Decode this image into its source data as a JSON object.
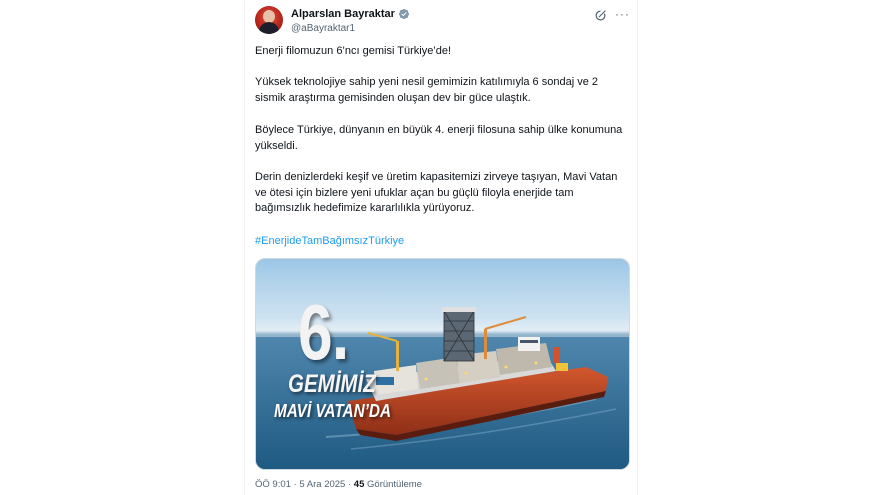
{
  "author": {
    "name": "Alparslan Bayraktar",
    "handle": "@aBayraktar1",
    "verified_color": "#829aab"
  },
  "tweet": {
    "paragraphs": [
      "Enerji filomuzun 6’ncı gemisi Türkiye’de!",
      "Yüksek teknolojiye sahip yeni nesil gemimizin katılımıyla 6 sondaj ve 2 sismik araştırma gemisinden oluşan dev bir güce ulaştık.",
      "Böylece Türkiye, dünyanın en büyük 4. enerji filosuna sahip ülke konumuna yükseldi.",
      "Derin denizlerdeki keşif ve üretim kapasitemizi zirveye taşıyan, Mavi Vatan ve ötesi için bizlere yeni ufuklar açan bu güçlü filoyla enerjide tam bağımsızlık hedefimize kararlılıkla yürüyoruz."
    ],
    "hashtag": "#EnerjideTamBağımsızTürkiye",
    "hashtag_color": "#1d9bf0"
  },
  "media": {
    "number": "6.",
    "line1": "GEMİMİZ",
    "line2": "MAVİ VATAN’DA"
  },
  "meta": {
    "time": "ÖÖ 9:01",
    "separator": " · ",
    "date": "5 Ara 2025",
    "views_count": "45",
    "views_label": "Görüntüleme"
  },
  "icons": {
    "grok": "grok-icon",
    "more": "more-icon",
    "verified": "verified-badge-icon"
  }
}
